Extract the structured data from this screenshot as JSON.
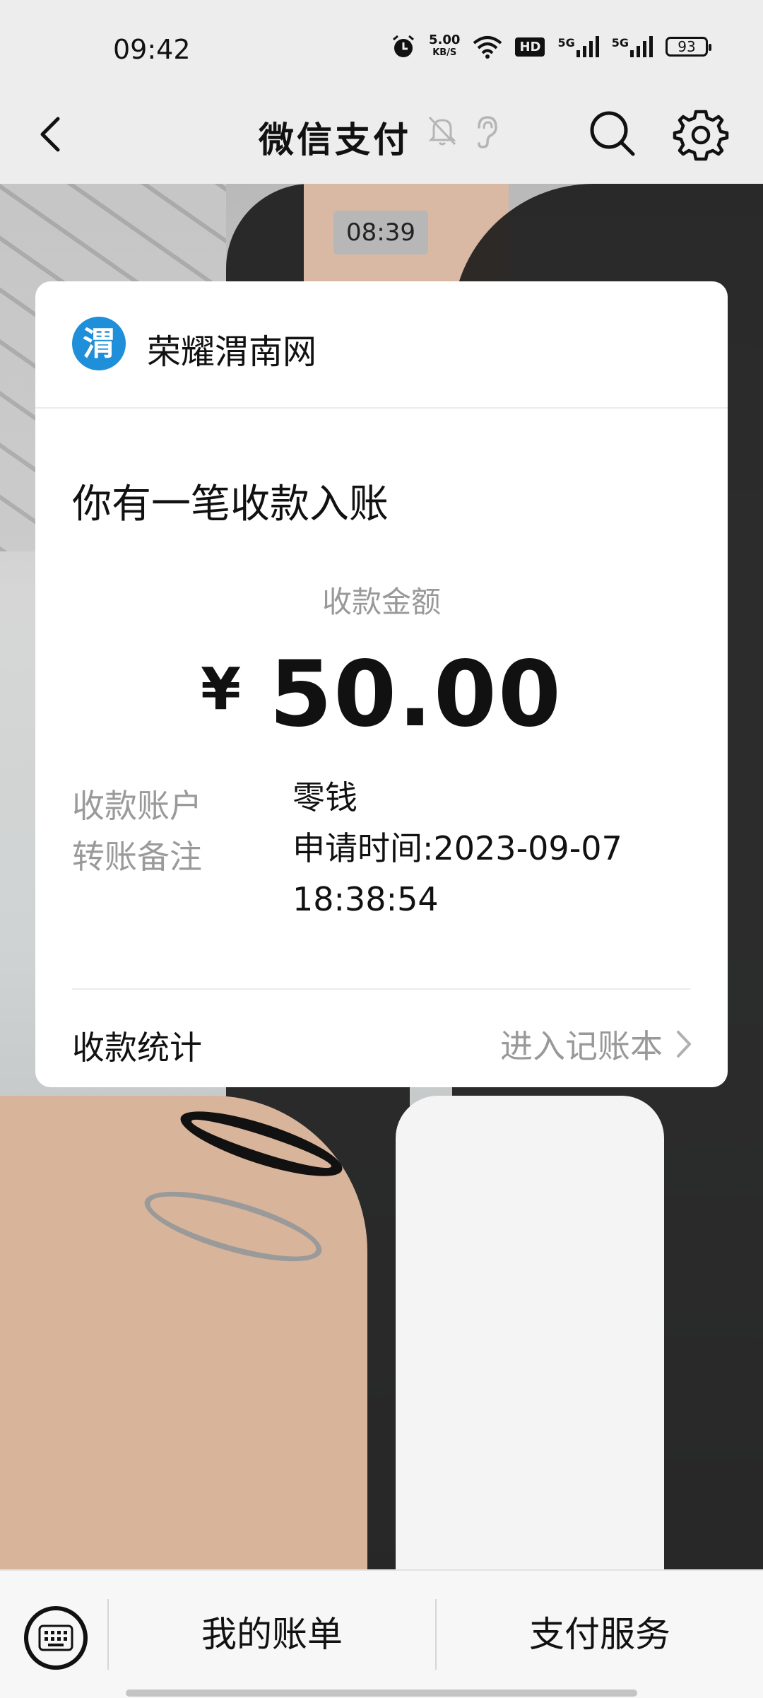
{
  "status_bar": {
    "time": "09:42",
    "net_speed": "5.00",
    "net_unit": "KB/S",
    "hd_badge": "HD",
    "signal1_label": "5G",
    "signal2_label": "5G",
    "battery": "93"
  },
  "nav": {
    "title": "微信支付"
  },
  "chat": {
    "timestamp": "08:39"
  },
  "card": {
    "merchant_logo_char": "渭",
    "merchant_name": "荣耀渭南网",
    "notice_title": "你有一笔收款入账",
    "amount_label": "收款金额",
    "currency": "¥",
    "amount": "50.00",
    "account_label": "收款账户",
    "account_value": "零钱",
    "remark_label": "转账备注",
    "remark_value": "申请时间:2023-09-07 18:38:54",
    "stats_label": "收款统计",
    "stats_link": "进入记账本"
  },
  "bottom_bar": {
    "menu1": "我的账单",
    "menu2": "支付服务"
  }
}
